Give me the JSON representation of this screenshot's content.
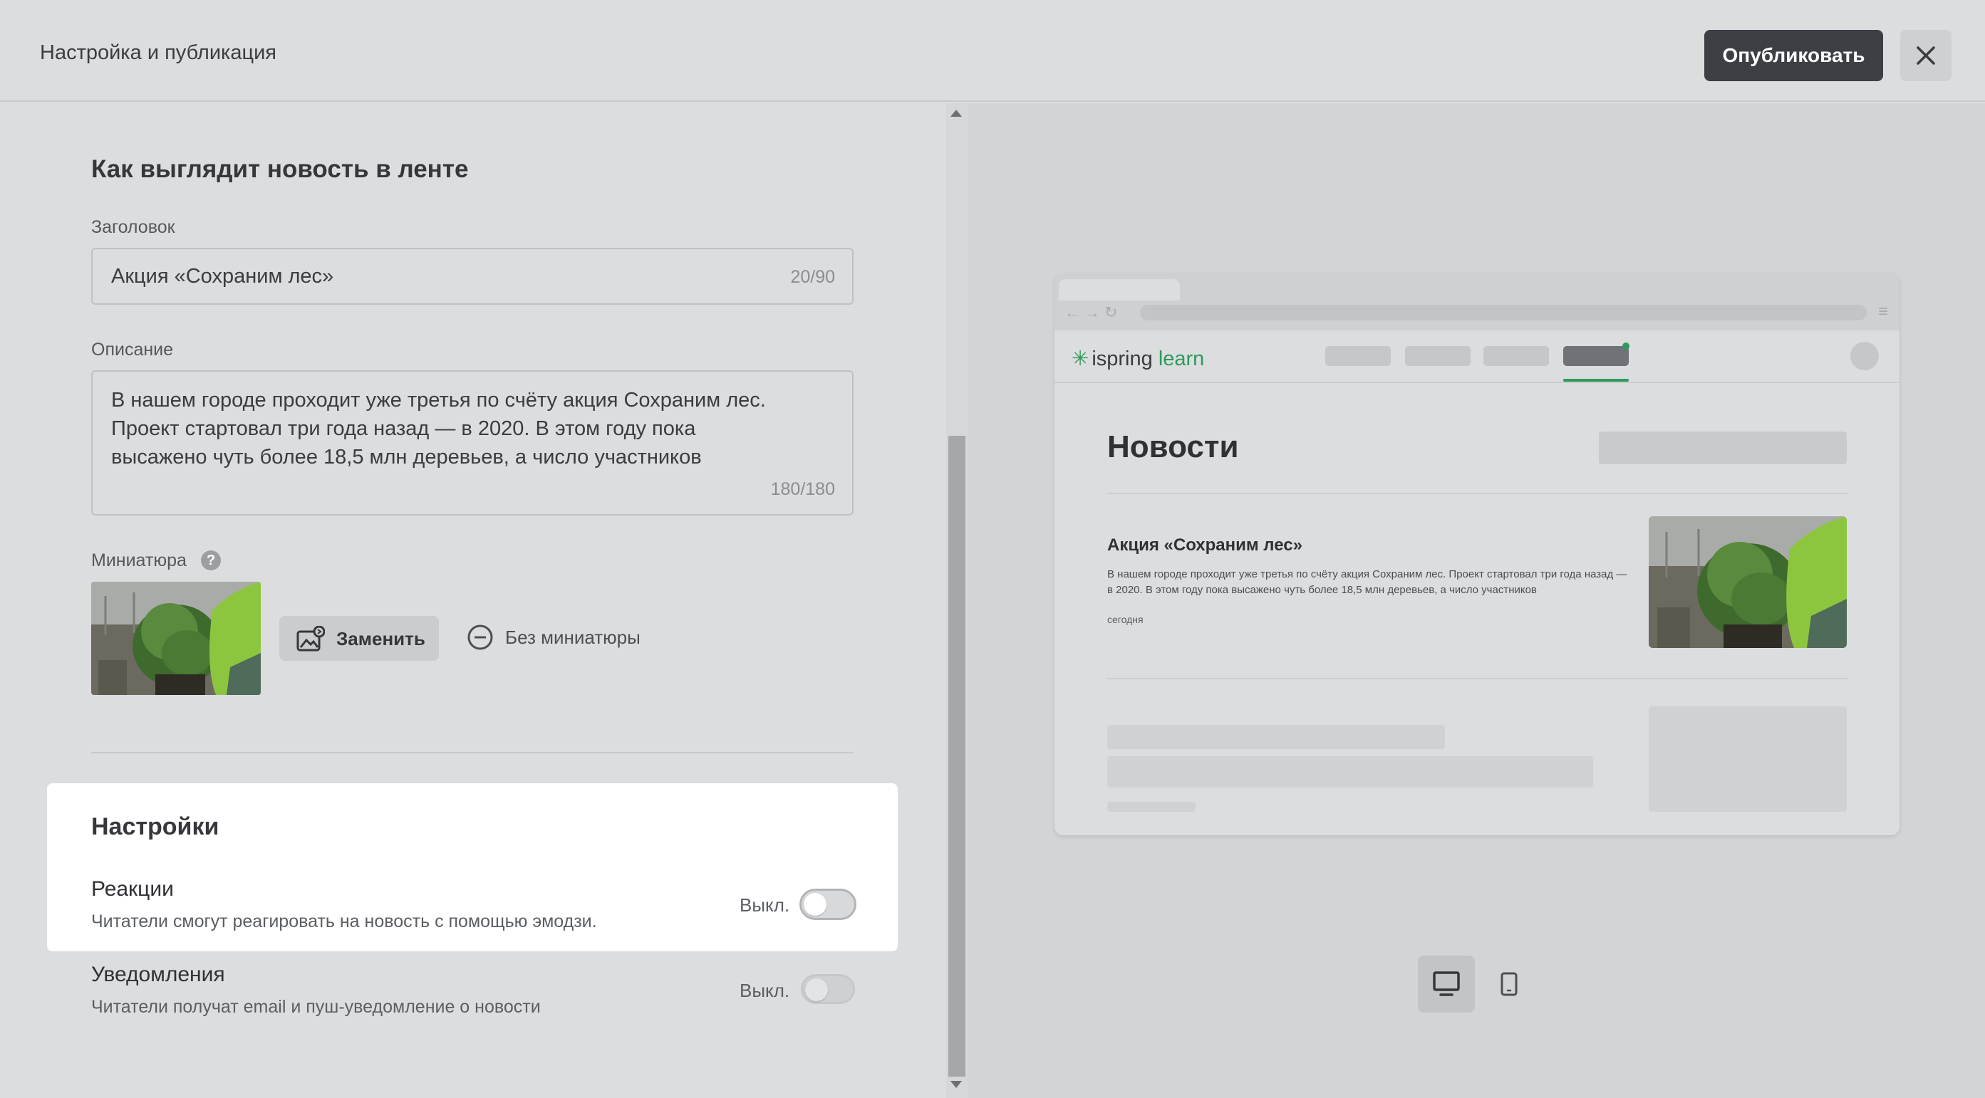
{
  "header": {
    "title": "Настройка и публикация",
    "publish_label": "Опубликовать",
    "close_icon": "close-icon"
  },
  "feed_section": {
    "title": "Как выглядит новость в ленте",
    "headline": {
      "label": "Заголовок",
      "value": "Акция «Сохраним лес»",
      "counter": "20/90"
    },
    "description": {
      "label": "Описание",
      "value": "В нашем городе проходит уже третья по счёту акция Сохраним лес. Проект стартовал три года назад — в 2020. В этом году пока высажено чуть более 18,5 млн деревьев, а число участников",
      "counter": "180/180"
    },
    "thumbnail": {
      "label": "Миниатюра",
      "help_icon": "?",
      "replace_label": "Заменить",
      "no_thumb_label": "Без миниатюры"
    }
  },
  "settings": {
    "title": "Настройки",
    "reactions": {
      "title": "Реакции",
      "description": "Читатели смогут реагировать на новость с помощью эмодзи.",
      "state_label": "Выкл.",
      "enabled": false
    },
    "notifications": {
      "title": "Уведомления",
      "description": "Читатели получат email и пуш-уведомление о новости",
      "state_label": "Выкл.",
      "enabled": false
    }
  },
  "preview": {
    "logo_main": "ispring",
    "logo_accent": "learn",
    "page_title": "Новости",
    "item_title": "Акция «Сохраним лес»",
    "item_text": "В нашем городе проходит уже третья по счёту акция Сохраним лес. Проект стартовал три года назад — в 2020. В этом году пока высажено чуть более 18,5 млн деревьев, а число участников",
    "item_date": "сегодня",
    "accent_color": "#2e9a5c"
  },
  "device_switch": {
    "desktop_icon": "desktop-icon",
    "mobile_icon": "mobile-icon",
    "selected": "desktop"
  }
}
